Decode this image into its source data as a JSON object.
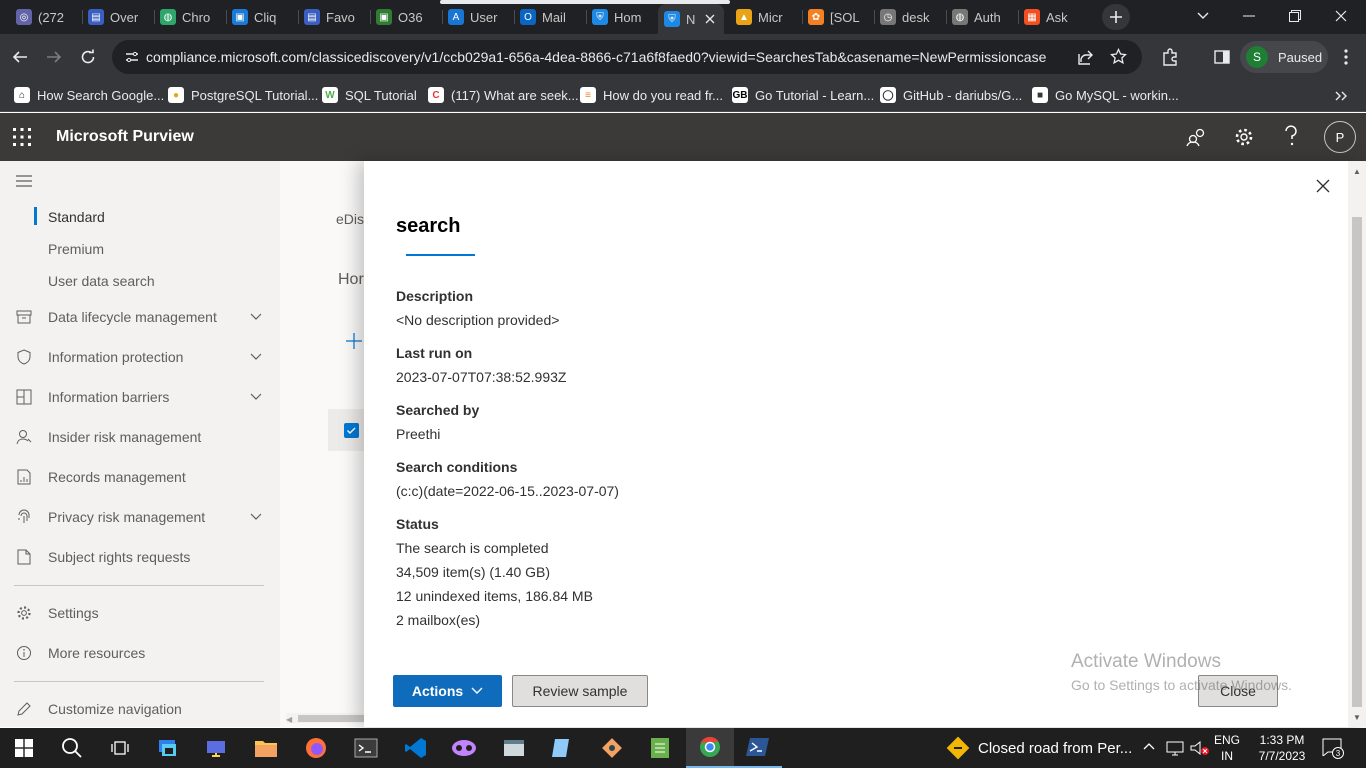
{
  "browser": {
    "tabs": [
      {
        "label": "(272",
        "color": "#6264a7",
        "glyph": "◎"
      },
      {
        "label": "Over",
        "color": "#3b5fc0",
        "glyph": "▤"
      },
      {
        "label": "Chro",
        "color": "#2ea56a",
        "glyph": "◍"
      },
      {
        "label": "Cliq",
        "color": "#1b79d8",
        "glyph": "▣"
      },
      {
        "label": "Favo",
        "color": "#3b5fc0",
        "glyph": "▤"
      },
      {
        "label": "O36",
        "color": "#2e7d32",
        "glyph": "▣"
      },
      {
        "label": "User",
        "color": "#1976d2",
        "glyph": "A"
      },
      {
        "label": "Mail",
        "color": "#0a66c2",
        "glyph": "O"
      },
      {
        "label": "Hom",
        "color": "#1e88e5",
        "glyph": "⛨"
      },
      {
        "label": "N",
        "color": "#1e88e5",
        "glyph": "⛨"
      },
      {
        "label": "Micr",
        "color": "#e8a317",
        "glyph": "▲"
      },
      {
        "label": "[SOL",
        "color": "#f48024",
        "glyph": "✿"
      },
      {
        "label": "desk",
        "color": "#777",
        "glyph": "◷"
      },
      {
        "label": "Auth",
        "color": "#777",
        "glyph": "◍"
      },
      {
        "label": "Ask",
        "color": "#f25022",
        "glyph": "▦"
      }
    ],
    "url": "compliance.microsoft.com/classicediscovery/v1/ccb029a1-656a-4dea-8866-c71a6f8faed0?viewid=SearchesTab&casename=NewPermissioncase",
    "profile_initial": "S",
    "profile_status": "Paused",
    "bookmarks": [
      {
        "label": "How Search Google...",
        "glyph": "⌂",
        "color": "#222"
      },
      {
        "label": "PostgreSQL Tutorial...",
        "glyph": "●",
        "color": "#e8a317"
      },
      {
        "label": "SQL Tutorial",
        "glyph": "W",
        "color": "#4caf50"
      },
      {
        "label": "(117) What are seek...",
        "glyph": "C",
        "color": "#e53935"
      },
      {
        "label": "How do you read fr...",
        "glyph": "≡",
        "color": "#f48024"
      },
      {
        "label": "Go Tutorial - Learn...",
        "glyph": "GB",
        "color": "#000"
      },
      {
        "label": "GitHub - dariubs/G...",
        "glyph": "◯",
        "color": "#333"
      },
      {
        "label": "Go MySQL - workin...",
        "glyph": "■",
        "color": "#35363a"
      }
    ]
  },
  "app": {
    "title": "Microsoft Purview",
    "user_initial": "P"
  },
  "nav": {
    "sub_items": [
      "Standard",
      "Premium",
      "User data search"
    ],
    "items": [
      {
        "label": "Data lifecycle management",
        "expandable": true,
        "icon": "archive-icon"
      },
      {
        "label": "Information protection",
        "expandable": true,
        "icon": "shield-icon"
      },
      {
        "label": "Information barriers",
        "expandable": true,
        "icon": "barrier-icon"
      },
      {
        "label": "Insider risk management",
        "expandable": false,
        "icon": "person-icon"
      },
      {
        "label": "Records management",
        "expandable": false,
        "icon": "records-icon"
      },
      {
        "label": "Privacy risk management",
        "expandable": true,
        "icon": "fingerprint-icon"
      },
      {
        "label": "Subject rights requests",
        "expandable": false,
        "icon": "document-icon"
      }
    ],
    "settings": "Settings",
    "more_resources": "More resources",
    "customize": "Customize navigation"
  },
  "background_page": {
    "breadcrumb_fragment": "eDisc",
    "heading_fragment": "Hor"
  },
  "panel": {
    "title": "search",
    "fields": [
      {
        "label": "Description",
        "values": [
          "<No description provided>"
        ]
      },
      {
        "label": "Last run on",
        "values": [
          "2023-07-07T07:38:52.993Z"
        ]
      },
      {
        "label": "Searched by",
        "values": [
          "Preethi"
        ]
      },
      {
        "label": "Search conditions",
        "values": [
          "(c:c)(date=2022-06-15..2023-07-07)"
        ]
      },
      {
        "label": "Status",
        "values": [
          "The search is completed",
          "34,509 item(s) (1.40 GB)",
          "12 unindexed items, 186.84 MB",
          "2 mailbox(es)"
        ]
      }
    ],
    "actions_label": "Actions",
    "review_label": "Review sample",
    "close_label": "Close"
  },
  "watermark": {
    "title": "Activate Windows",
    "subtitle": "Go to Settings to activate Windows."
  },
  "taskbar": {
    "notification": "Closed road from Per...",
    "lang_1": "ENG",
    "lang_2": "IN",
    "time": "1:33 PM",
    "date": "7/7/2023",
    "notif_count": "3"
  }
}
